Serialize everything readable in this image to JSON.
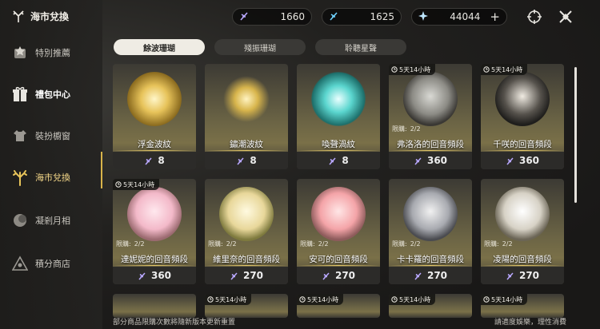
{
  "header": {
    "title": "海市兌換"
  },
  "sidebar": {
    "items": [
      {
        "label": "特別推薦",
        "icon": "star-badge-icon"
      },
      {
        "label": "禮包中心",
        "icon": "gift-icon"
      },
      {
        "label": "裝扮櫥窗",
        "icon": "shirt-icon"
      },
      {
        "label": "海市兌換",
        "icon": "coral-icon",
        "active": true
      },
      {
        "label": "凝剎月相",
        "icon": "moon-orb-icon"
      },
      {
        "label": "積分商店",
        "icon": "triangle-shop-icon"
      }
    ]
  },
  "currencies": [
    {
      "value": "1660",
      "icon": "feather-icon"
    },
    {
      "value": "1625",
      "icon": "feather-blue-icon"
    },
    {
      "value": "44044",
      "icon": "star-crystal-icon",
      "add": "+"
    }
  ],
  "tabs": [
    {
      "label": "餘波珊瑚",
      "active": true
    },
    {
      "label": "殘振珊瑚"
    },
    {
      "label": "聆聽星聲"
    }
  ],
  "cards": [
    {
      "name": "浮金波紋",
      "price": "8",
      "art": "gold"
    },
    {
      "name": "鏽潮波紋",
      "price": "8",
      "art": "dagger"
    },
    {
      "name": "喚聲渦紋",
      "price": "8",
      "art": "teal"
    },
    {
      "name": "弗洛洛的回音頻段",
      "price": "360",
      "timer": "5天14小時",
      "limit": "限購:",
      "limit_val": "2/2",
      "art": "char1"
    },
    {
      "name": "千咲的回音頻段",
      "price": "360",
      "timer": "5天14小時",
      "art": "char2"
    },
    {
      "name": "達妮妮的回音頻段",
      "price": "360",
      "timer": "5天14小時",
      "limit": "限購:",
      "limit_val": "2/2",
      "art": "char3"
    },
    {
      "name": "維里奈的回音頻段",
      "price": "270",
      "limit": "限購:",
      "limit_val": "2/2",
      "art": "char4"
    },
    {
      "name": "安可的回音頻段",
      "price": "270",
      "limit": "限購:",
      "limit_val": "2/2",
      "art": "char5"
    },
    {
      "name": "卡卡羅的回音頻段",
      "price": "270",
      "limit": "限購:",
      "limit_val": "2/2",
      "art": "char6"
    },
    {
      "name": "凌陽的回音頻段",
      "price": "270",
      "limit": "限購:",
      "limit_val": "2/2",
      "art": "char7"
    }
  ],
  "bottom_timers": [
    "5天14小時",
    "5天14小時",
    "5天14小時",
    "5天14小時"
  ],
  "footer": {
    "left": "部分商品限購次數將隨新版本更新重置",
    "right": "請適度娛樂，理性消費"
  }
}
